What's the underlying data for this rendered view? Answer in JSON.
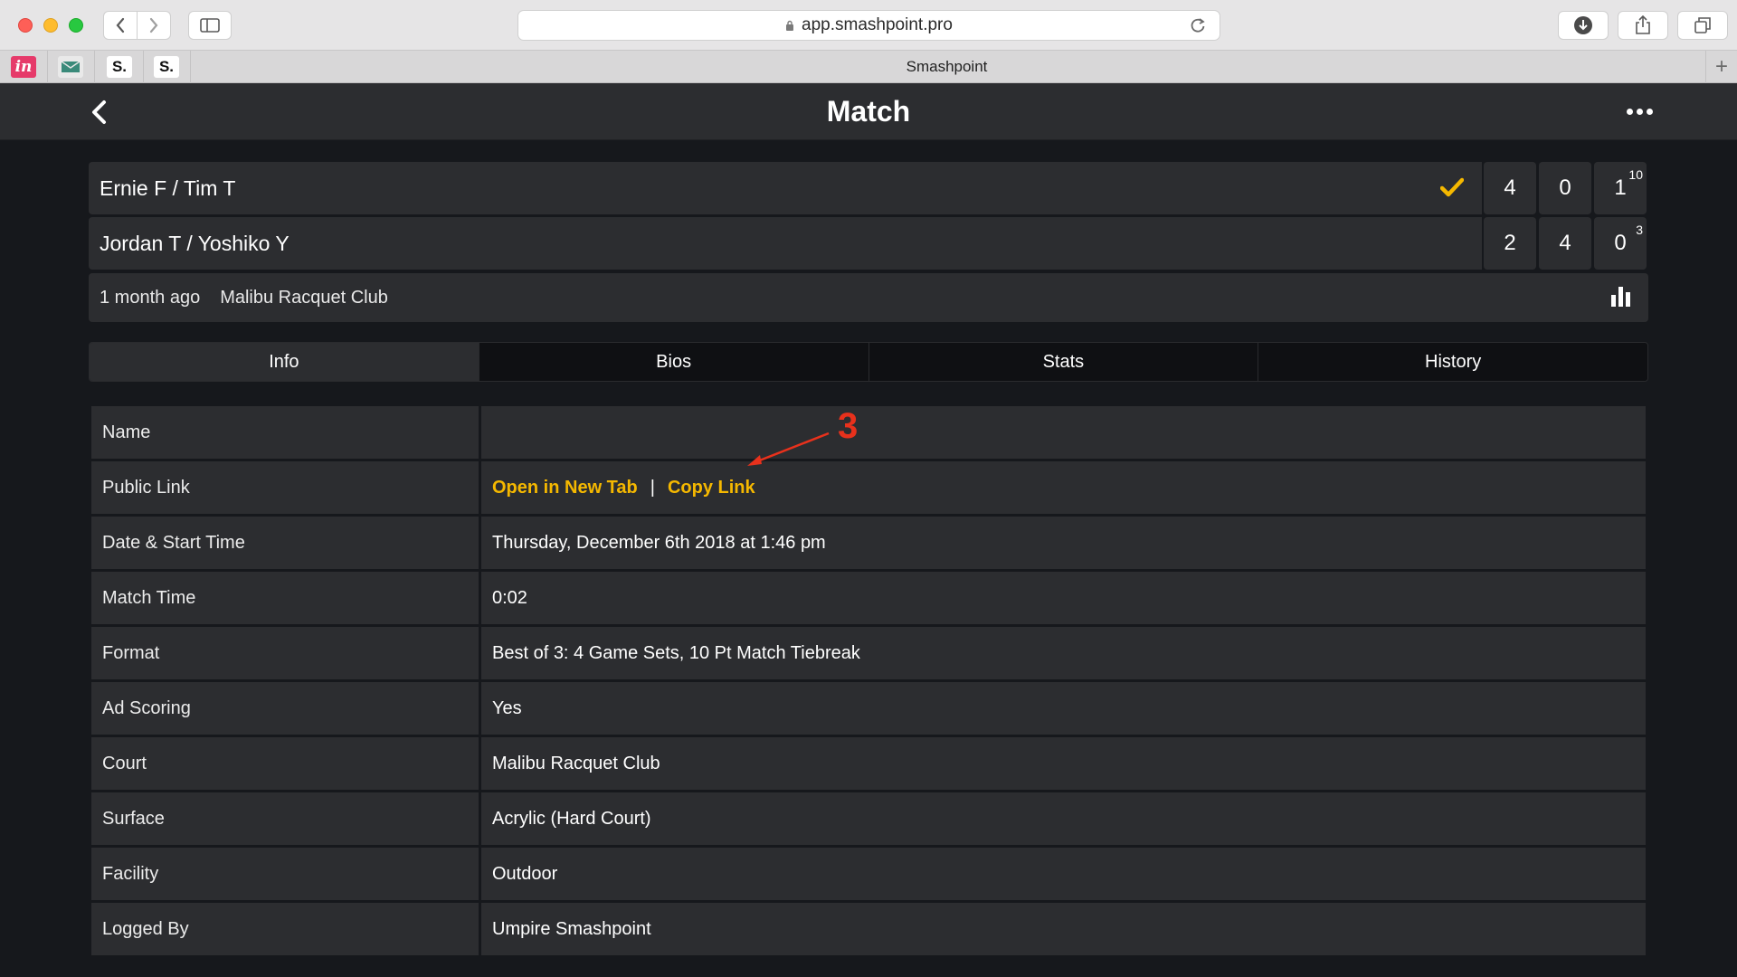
{
  "browser": {
    "url": "app.smashpoint.pro",
    "tab_title": "Smashpoint",
    "favicons": [
      "in",
      "",
      "S.",
      "S."
    ]
  },
  "header": {
    "title": "Match"
  },
  "match": {
    "teams": [
      {
        "name": "Ernie F / Tim T",
        "winner": true,
        "sets": [
          "4",
          "0",
          "1"
        ],
        "tiebreak": "10"
      },
      {
        "name": "Jordan T / Yoshiko Y",
        "winner": false,
        "sets": [
          "2",
          "4",
          "0"
        ],
        "tiebreak": "3"
      }
    ],
    "when": "1 month ago",
    "venue": "Malibu Racquet Club"
  },
  "tabs": [
    {
      "label": "Info",
      "active": true
    },
    {
      "label": "Bios",
      "active": false
    },
    {
      "label": "Stats",
      "active": false
    },
    {
      "label": "History",
      "active": false
    }
  ],
  "info": {
    "rows": [
      {
        "label": "Name",
        "value": ""
      },
      {
        "label": "Public Link",
        "value": ""
      },
      {
        "label": "Date & Start Time",
        "value": "Thursday, December 6th 2018 at 1:46 pm"
      },
      {
        "label": "Match Time",
        "value": "0:02"
      },
      {
        "label": "Format",
        "value": "Best of 3: 4 Game Sets, 10 Pt Match Tiebreak"
      },
      {
        "label": "Ad Scoring",
        "value": "Yes"
      },
      {
        "label": "Court",
        "value": "Malibu Racquet Club"
      },
      {
        "label": "Surface",
        "value": "Acrylic (Hard Court)"
      },
      {
        "label": "Facility",
        "value": "Outdoor"
      },
      {
        "label": "Logged By",
        "value": "Umpire Smashpoint"
      }
    ],
    "public_link": {
      "open_label": "Open in New Tab",
      "separator": "|",
      "copy_label": "Copy Link"
    }
  },
  "annotation": {
    "number": "3",
    "color": "#e8311c"
  },
  "colors": {
    "accent": "#f5b800",
    "panel": "#2c2d30",
    "background": "#16181c"
  }
}
